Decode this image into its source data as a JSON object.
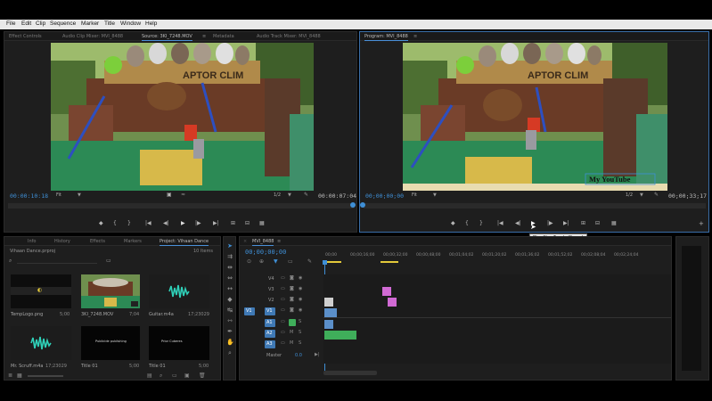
{
  "menu": [
    "File",
    "Edit",
    "Clip",
    "Sequence",
    "Marker",
    "Title",
    "Window",
    "Help"
  ],
  "source_panel": {
    "tabs": [
      "Effect Controls",
      "Audio Clip Mixer: MVI_8488",
      "Source: 3KI_7248.MOV",
      "Metadata",
      "Audio Track Mixer: MVI_8488"
    ],
    "active_tab_index": 2,
    "timecode_in": "00:00:10:18",
    "fit": "Fit",
    "resolution": "1/2",
    "timecode_out": "00:00:07:04"
  },
  "program_panel": {
    "tab": "Program: MVI_8488",
    "timecode_in": "00;00;00;00",
    "fit": "Fit",
    "resolution": "1/2",
    "timecode_out": "00;00;33;17",
    "title_overlay": "My YouTube",
    "tooltip": "Play-Stop Toggle (Space)"
  },
  "scene": {
    "sign_text": "APTOR CLIM"
  },
  "project_panel": {
    "tabs": [
      "Info",
      "History",
      "Effects",
      "Markers",
      "Project: Vihaan Dance"
    ],
    "active_tab_index": 4,
    "file": "Vihaan Dance.prproj",
    "count": "10 Items",
    "items": [
      {
        "name": "TempLogo.png",
        "meta": "5;00",
        "kind": "logo"
      },
      {
        "name": "3KI_7248.MOV",
        "meta": "7;04",
        "kind": "video"
      },
      {
        "name": "Guitar.m4a",
        "meta": "17;23029",
        "kind": "audio"
      },
      {
        "name": "Mr. Scruff.m4a",
        "meta": "17;23029",
        "kind": "audio"
      },
      {
        "name": "Title 01",
        "meta": "5;00",
        "kind": "title"
      },
      {
        "name": "Title 01",
        "meta": "5;00",
        "kind": "title2"
      }
    ],
    "title_thumb_1": "Publicide publishing",
    "title_thumb_2": "Prior Cuberes"
  },
  "timeline": {
    "tab": "MVI_8488",
    "timecode": "00;00;00;00",
    "ruler": [
      "00;00",
      "00;00;16;00",
      "00;00;32;00",
      "00;00;48;00",
      "00;01;04;02",
      "00;01;20;02",
      "00;01;36;02",
      "00;01;52;02",
      "00;02;08;04",
      "00;02;24;04"
    ],
    "tracks": [
      {
        "name": "V4",
        "type": "video",
        "target": ""
      },
      {
        "name": "V3",
        "type": "video",
        "target": ""
      },
      {
        "name": "V2",
        "type": "video",
        "target": ""
      },
      {
        "name": "V1",
        "type": "video",
        "target": "V1"
      },
      {
        "name": "A1",
        "type": "audio",
        "target": "A1"
      },
      {
        "name": "A2",
        "type": "audio",
        "target": ""
      },
      {
        "name": "A3",
        "type": "audio",
        "target": ""
      }
    ],
    "master": "Master",
    "master_value": "0.0"
  },
  "colors": {
    "accent_blue": "#3f8fd6",
    "clip_pink": "#d16ad4",
    "clip_blue": "#5b8fc9",
    "clip_green": "#3fae5a",
    "ruler_yellow": "#e3c93a"
  }
}
